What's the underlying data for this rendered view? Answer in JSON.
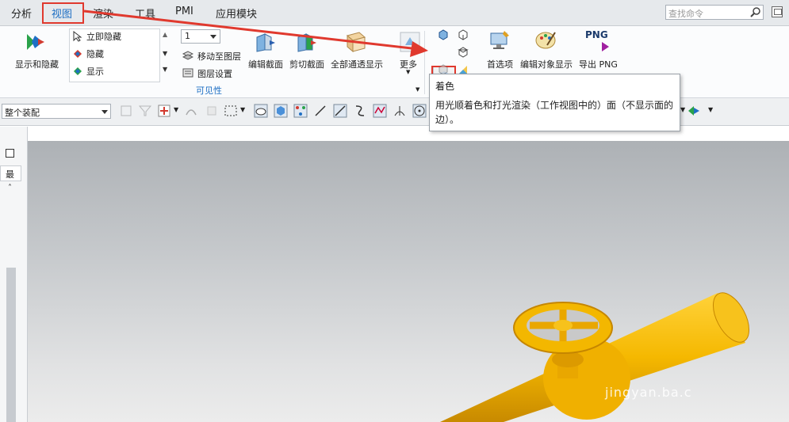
{
  "menubar": {
    "items": [
      "分析",
      "视图",
      "渲染",
      "工具",
      "PMI",
      "应用模块"
    ],
    "active": "视图",
    "search_placeholder": "查找命令"
  },
  "ribbon": {
    "show_hide": "显示和隐藏",
    "hide_now": "立即隐藏",
    "hide": "隐藏",
    "show": "显示",
    "layer_value": "1",
    "move_to_layer": "移动至图层",
    "layer_settings": "图层设置",
    "visibility_group": "可见性",
    "edit_section": "编辑截面",
    "clip_section": "剪切截面",
    "all_see_through": "全部通透显示",
    "more": "更多",
    "preferences": "首选项",
    "edit_object_display": "编辑对象显示",
    "png_icon_text": "PNG",
    "export_png": "导出 PNG"
  },
  "toolbar": {
    "assembly_filter": "整个装配"
  },
  "tooltip": {
    "title": "着色",
    "body": "用光顺着色和打光渲染（工作视图中的）面（不显示面的边）。"
  },
  "leftpanel": {
    "label": "最"
  },
  "watermark": "jingyan.ba.c",
  "colors": {
    "accent": "#1e6fc4",
    "highlight_red": "#e0392e",
    "model_yellow": "#f5b800"
  }
}
